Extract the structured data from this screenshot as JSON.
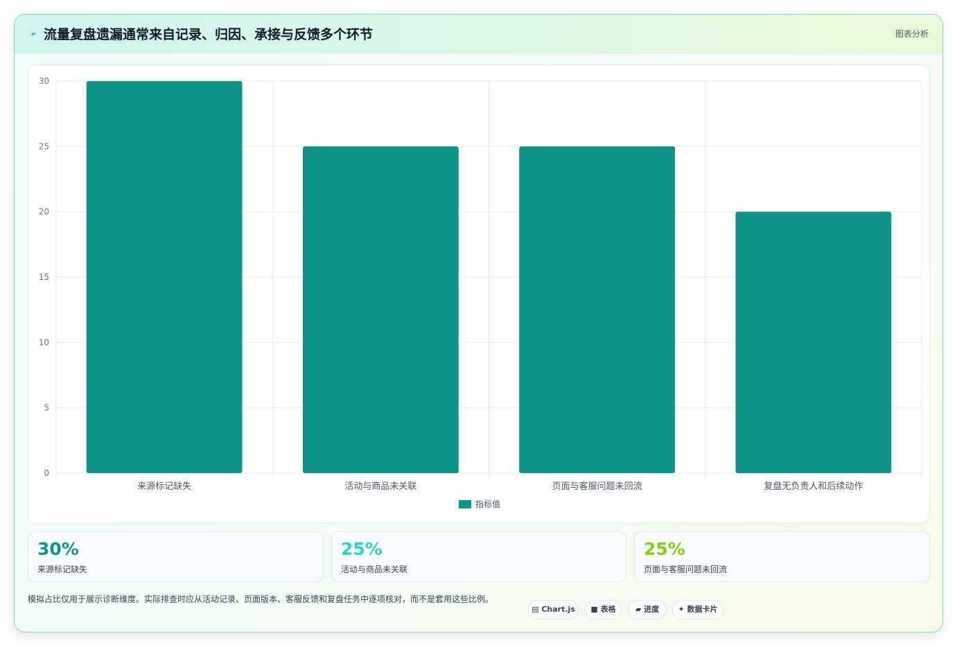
{
  "header": {
    "icon": "bolt-icon",
    "title": "流量复盘遗漏通常来自记录、归因、承接与反馈多个环节",
    "tag": "图表分析"
  },
  "chart_data": {
    "type": "bar",
    "categories": [
      "来源标记缺失",
      "活动与商品未关联",
      "页面与客服问题未回流",
      "复盘无负责人和后续动作"
    ],
    "series": [
      {
        "name": "指标值",
        "values": [
          30,
          25,
          25,
          20
        ],
        "color": "#0e9488"
      }
    ],
    "yticks": [
      "0",
      "5",
      "10",
      "15",
      "20",
      "25",
      "30"
    ],
    "ylim": [
      0,
      30
    ],
    "grid": true,
    "legend": "bottom"
  },
  "stats": [
    {
      "value": "30%",
      "label": "来源标记缺失",
      "color": "#0e9488"
    },
    {
      "value": "25%",
      "label": "活动与商品未关联",
      "color": "#2dd4bf"
    },
    {
      "value": "25%",
      "label": "页面与客服问题未回流",
      "color": "#84cc16"
    }
  ],
  "note": "模拟占比仅用于展示诊断维度。实际排查时应从活动记录、页面版本、客服反馈和复盘任务中逐项核对，而不是套用这些比例。",
  "chips": [
    {
      "icon": "chart-icon",
      "label": "Chart.js"
    },
    {
      "icon": "table-icon",
      "label": "表格"
    },
    {
      "icon": "progress-icon",
      "label": "进度"
    },
    {
      "icon": "sparkle-icon",
      "label": "数据卡片"
    }
  ]
}
